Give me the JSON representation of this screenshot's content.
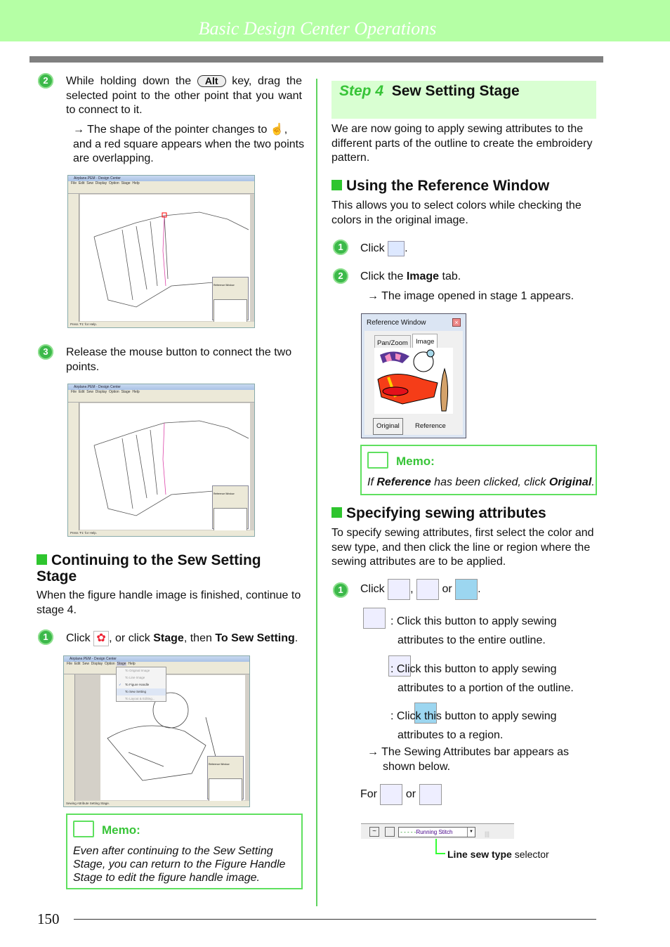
{
  "header": {
    "title": "Basic Design Center Operations"
  },
  "left": {
    "step2": {
      "num": "2",
      "pre": "While holding down the",
      "key": "Alt",
      "post": "key, drag the selected point to the other point that you want to connect to it.",
      "arrow": "→",
      "result_a": "The shape of the pointer changes to",
      "result_b": ", and a red square appears when the two points are overlapping."
    },
    "step3": {
      "num": "3",
      "text": "Release the mouse button to connect the two points."
    },
    "section": {
      "title": "Continuing to the Sew Setting Stage",
      "intro": "When the figure handle image is finished, continue to stage 4."
    },
    "step1": {
      "num": "1",
      "click": "Click",
      "mid": ", or click",
      "stage": "Stage",
      "then": ", then",
      "sew": "To Sew Setting",
      "end": "."
    },
    "memo": {
      "title": "Memo:",
      "text": "Even after continuing to the Sew Setting Stage, you can return to the Figure Handle Stage to edit the figure handle image."
    }
  },
  "screens": {
    "title": "Airplane.PEM - Design Center",
    "menus": [
      "File",
      "Edit",
      "Sew",
      "Display",
      "Option",
      "Stage",
      "Help"
    ],
    "status1": "Press 'F1' for Help.",
    "status3": "Sewing Attribute Setting Stage.",
    "ref_title": "Reference Window",
    "ref_tabs": [
      "Pan/Zoom",
      "Image"
    ],
    "stage_menu": [
      "To Original Image",
      "To Line Image",
      "To Figure Handle",
      "To Sew Setting",
      "To Layout & Editing..."
    ],
    "checked": "✓"
  },
  "right": {
    "step": {
      "label": "Step 4",
      "title": "Sew Setting Stage"
    },
    "intro": "We are now going to apply sewing attributes to the different parts of the outline to create the embroidery pattern.",
    "ref_section": {
      "title": "Using the Reference Window",
      "intro": "This allows you to select colors while checking the colors in the original image.",
      "s1": {
        "num": "1",
        "click": "Click",
        "end": "."
      },
      "s2": {
        "num": "2",
        "pre": "Click the",
        "bold": "Image",
        "post": "tab.",
        "arrow": "→",
        "result": "The image opened in stage 1 appears."
      }
    },
    "ref_window": {
      "title": "Reference Window",
      "tabs": [
        "Pan/Zoom",
        "Image"
      ],
      "buttons": [
        "Original",
        "Reference"
      ]
    },
    "memo": {
      "title": "Memo:",
      "a": "If",
      "b": "Reference",
      "c": "has been clicked, click",
      "d": "Original",
      "e": "."
    },
    "attr_section": {
      "title": "Specifying sewing attributes",
      "intro": "To specify sewing attributes, first select the color and sew type, and then click the line or region where the sewing attributes are to be applied.",
      "s1": {
        "num": "1",
        "click": "Click",
        "comma": ",",
        "or": "or",
        "end": "."
      },
      "d1": ": Click this button to apply sewing attributes to the entire outline.",
      "d2": ": Click this button to apply sewing attributes to a portion of the outline.",
      "d3": ": Click this button to apply sewing attributes to a region.",
      "arrow": "→",
      "result": "The Sewing Attributes bar appears as shown below.",
      "for": "For",
      "or": "or"
    },
    "sewbar": {
      "stitch": "Running Stitch",
      "callout_bold": "Line sew type",
      "callout": "selector"
    }
  },
  "footer": {
    "page": "150"
  },
  "colors": {
    "accent": "#3cb94a",
    "header": "#b5ffa5",
    "step_bg": "#d9ffd2"
  }
}
